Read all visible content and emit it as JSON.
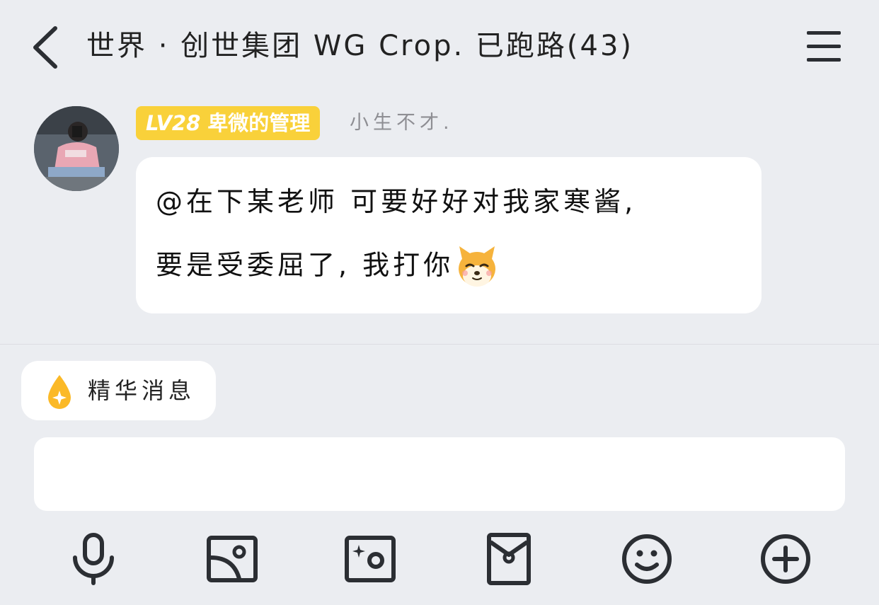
{
  "header": {
    "title": "世界 · 创世集团 WG Crop. 已跑路(43)",
    "back_icon": "chevron-left-icon",
    "menu_icon": "hamburger-menu-icon"
  },
  "message": {
    "badge_level": "LV28",
    "badge_title": "卑微的管理",
    "nickname": "小生不才.",
    "line1": "@在下某老师 可要好好对我家寒酱,",
    "line2": "要是受委屈了, 我打你",
    "emoji": "doge-emoji-icon"
  },
  "featured": {
    "label": "精华消息",
    "icon": "flame-drop-icon"
  },
  "input": {
    "value": "",
    "placeholder": ""
  },
  "toolbar": {
    "items": [
      "microphone-icon",
      "image-icon",
      "camera-icon",
      "red-packet-icon",
      "emoji-smile-icon",
      "plus-circle-icon"
    ]
  },
  "colors": {
    "background": "#ebedf1",
    "badge": "#f9d13a",
    "icon": "#2b2e33",
    "bubble": "#ffffff"
  }
}
